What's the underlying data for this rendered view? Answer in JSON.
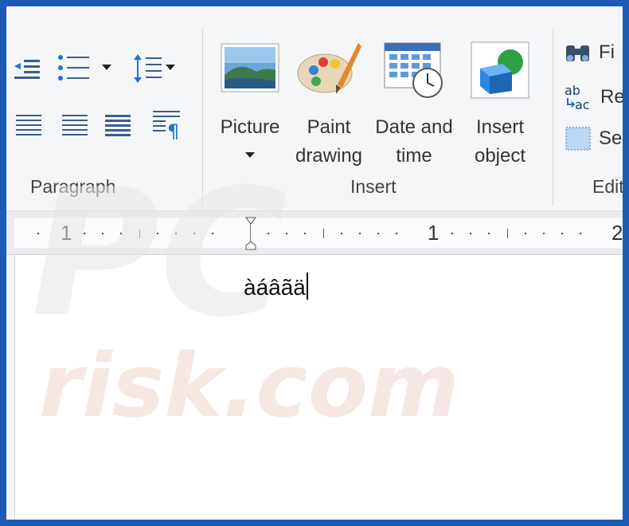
{
  "ribbon": {
    "groups": {
      "paragraph": "Paragraph",
      "insert": "Insert",
      "editing": "Edit"
    },
    "insert": {
      "picture": "Picture",
      "paint_line1": "Paint",
      "paint_line2": "drawing",
      "date_line1": "Date and",
      "date_line2": "time",
      "object_line1": "Insert",
      "object_line2": "object"
    },
    "editing": {
      "find": "Fi",
      "replace": "Re",
      "select": "Se"
    }
  },
  "ruler": {
    "labels": [
      "1",
      "1",
      "2"
    ]
  },
  "document": {
    "text": "àáâãä"
  },
  "watermark": {
    "line1": "PC",
    "line2": "risk.com"
  },
  "colors": {
    "frame": "#1e5bb8",
    "ribbon_bg": "#f5f6f7",
    "doc_bg": "#ffffff"
  }
}
